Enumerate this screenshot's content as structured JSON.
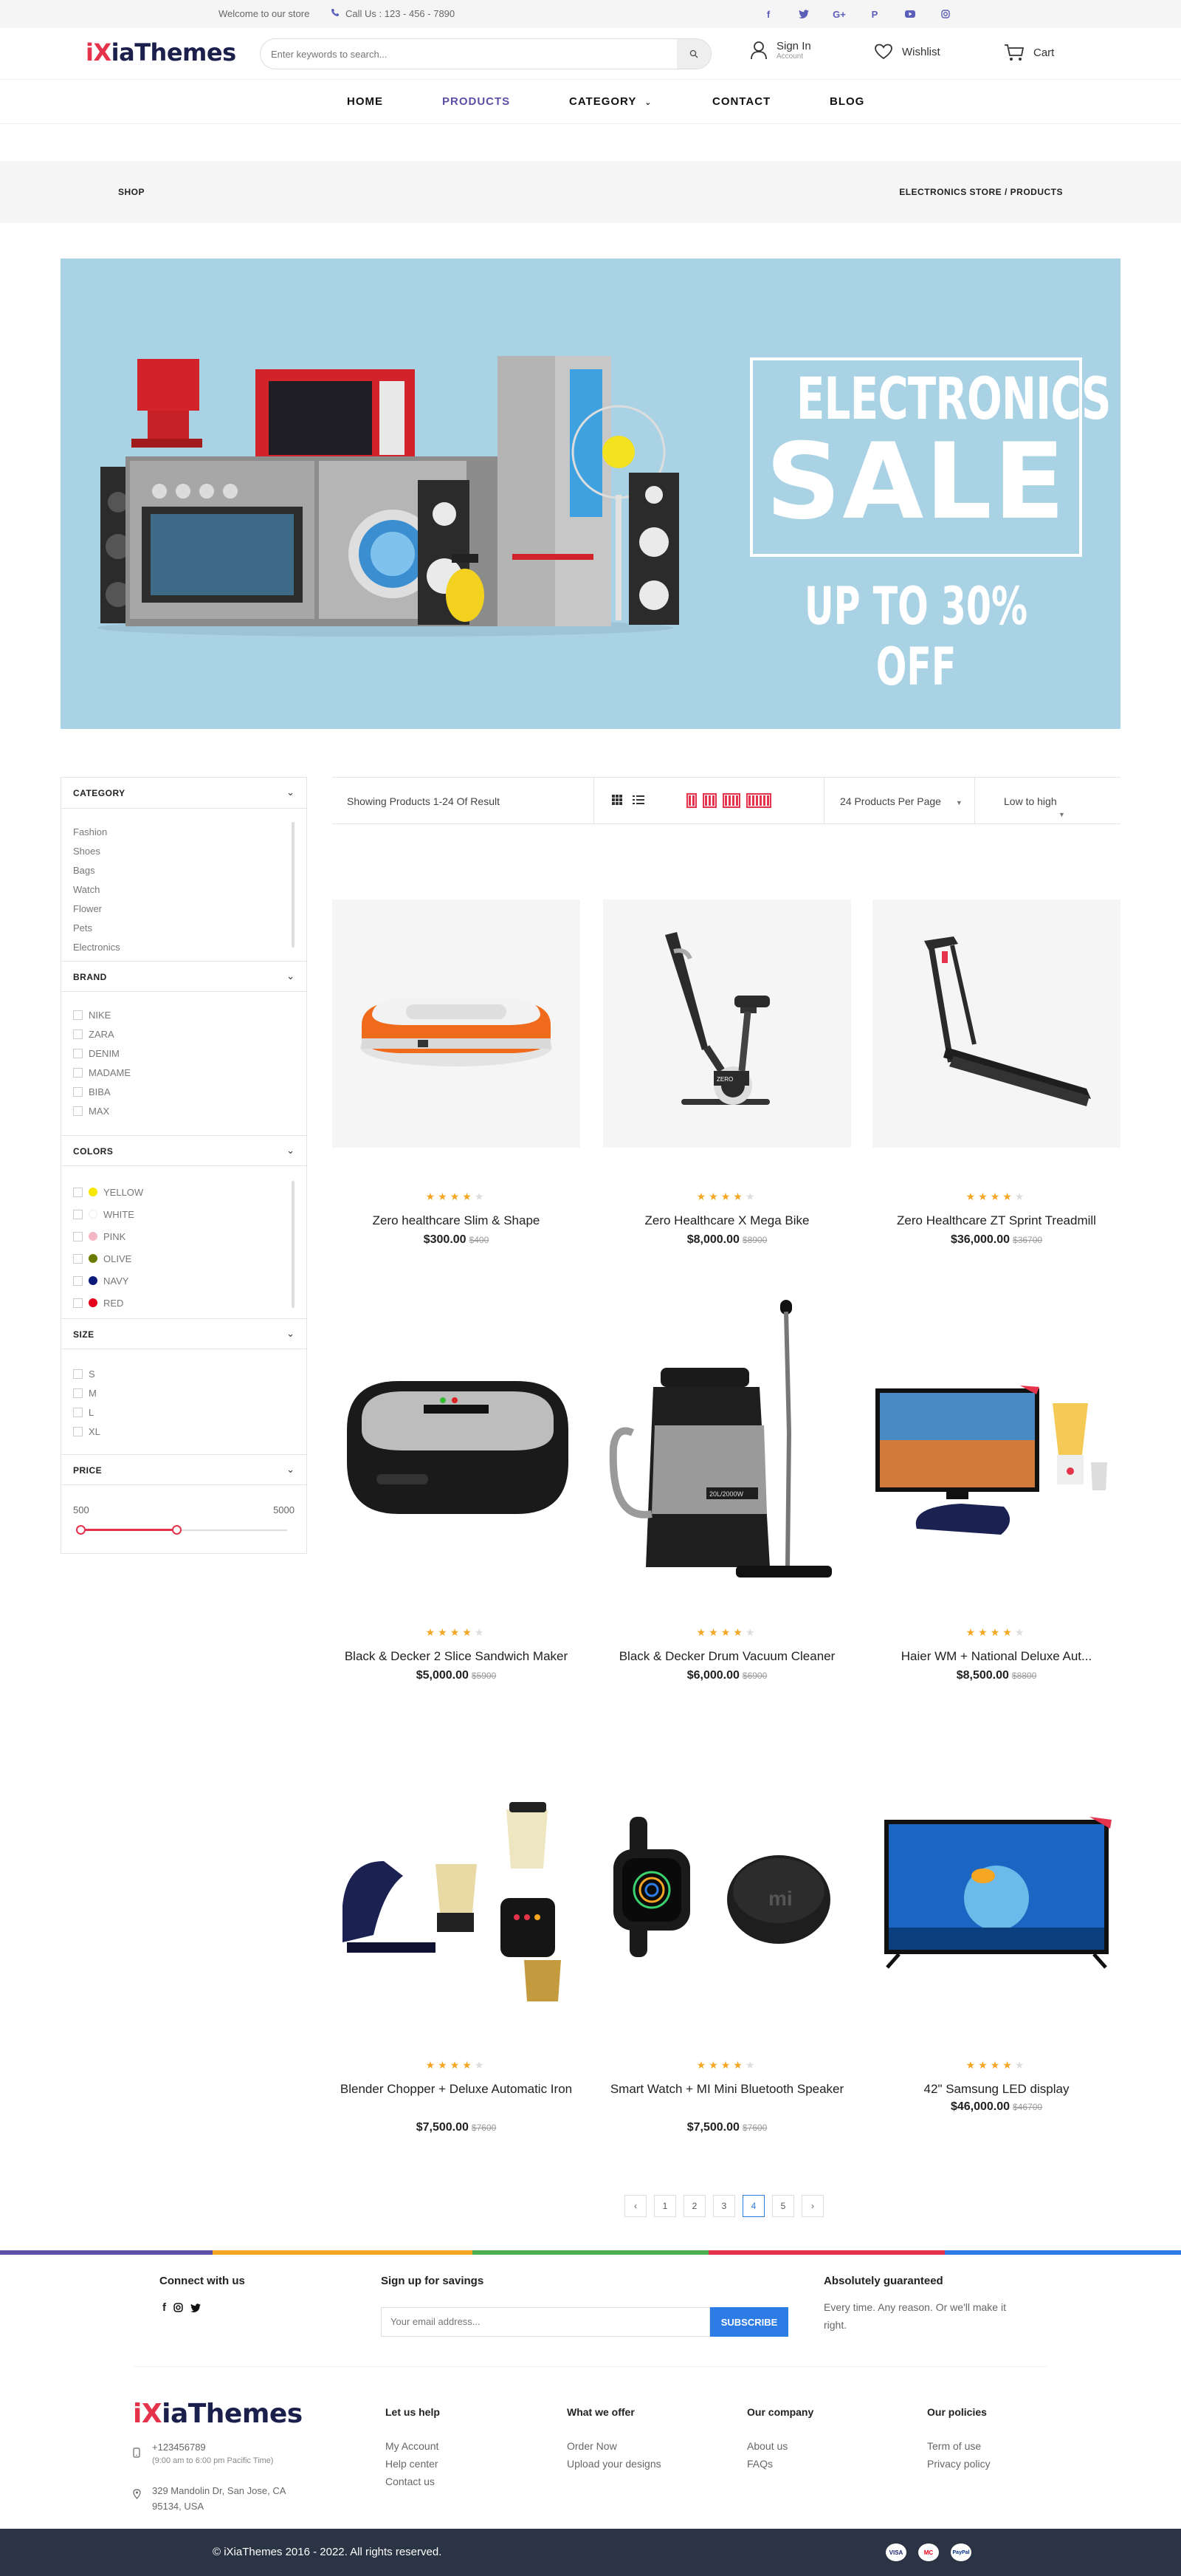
{
  "topbar": {
    "welcome": "Welcome to our store",
    "call": "Call Us : 123 - 456 - 7890",
    "socials": [
      "facebook-icon",
      "twitter-icon",
      "google-plus-icon",
      "pinterest-icon",
      "youtube-icon",
      "instagram-icon"
    ]
  },
  "header": {
    "logo_prefix": "iX",
    "logo_rest": "iaThemes",
    "search_placeholder": "Enter keywords to search...",
    "signin": "Sign In",
    "account": "Account",
    "wishlist": "Wishlist",
    "cart": "Cart"
  },
  "nav": {
    "home": "HOME",
    "products": "PRODUCTS",
    "category": "CATEGORY",
    "contact": "CONTACT",
    "blog": "BLOG"
  },
  "breadcrumb": {
    "left": "SHOP",
    "right": "ELECTRONICS STORE / PRODUCTS"
  },
  "banner": {
    "line1": "ELECTRONICS",
    "line2": "SALE",
    "line3": "UP TO 30% OFF",
    "bg": "#a9d2e4"
  },
  "sidebar": {
    "category": {
      "title": "CATEGORY",
      "items": [
        "Fashion",
        "Shoes",
        "Bags",
        "Watch",
        "Flower",
        "Pets",
        "Electronics"
      ]
    },
    "brand": {
      "title": "BRAND",
      "items": [
        "NIKE",
        "ZARA",
        "DENIM",
        "MADAME",
        "BIBA",
        "MAX"
      ]
    },
    "colors": {
      "title": "COLORS",
      "items": [
        {
          "name": "YELLOW",
          "color": "#f7e600"
        },
        {
          "name": "WHITE",
          "color": "#ffffff"
        },
        {
          "name": "PINK",
          "color": "#f5b7c5"
        },
        {
          "name": "OLIVE",
          "color": "#6b7a00"
        },
        {
          "name": "NAVY",
          "color": "#0a1a7a"
        },
        {
          "name": "RED",
          "color": "#e5001b"
        }
      ]
    },
    "size": {
      "title": "SIZE",
      "items": [
        "S",
        "M",
        "L",
        "XL"
      ]
    },
    "price": {
      "title": "PRICE",
      "min": "500",
      "max": "5000"
    }
  },
  "toolbar": {
    "showing": "Showing Products 1-24 Of Result",
    "per_page": "24 Products Per Page",
    "sort": "Low to high"
  },
  "products": [
    {
      "name": "Zero healthcare Slim & Shape",
      "price": "$300.00",
      "old": "$400",
      "rating": 4
    },
    {
      "name": "Zero Healthcare X Mega Bike",
      "price": "$8,000.00",
      "old": "$8900",
      "rating": 4
    },
    {
      "name": "Zero Healthcare ZT Sprint Treadmill",
      "price": "$36,000.00",
      "old": "$36700",
      "rating": 4
    },
    {
      "name": "Black & Decker 2 Slice Sandwich Maker",
      "price": "$5,000.00",
      "old": "$5900",
      "rating": 4
    },
    {
      "name": "Black & Decker Drum Vacuum Cleaner",
      "price": "$6,000.00",
      "old": "$6900",
      "rating": 4
    },
    {
      "name": "Haier WM + National Deluxe Aut...",
      "price": "$8,500.00",
      "old": "$8800",
      "rating": 4
    },
    {
      "name": "Blender Chopper + Deluxe Automatic Iron",
      "price": "$7,500.00",
      "old": "$7600",
      "rating": 4
    },
    {
      "name": "Smart Watch + MI Mini Bluetooth Speaker",
      "price": "$7,500.00",
      "old": "$7600",
      "rating": 4
    },
    {
      "name": "42\" Samsung LED display",
      "price": "$46,000.00",
      "old": "$46700",
      "rating": 4
    }
  ],
  "pagination": {
    "prev": "‹",
    "pages": [
      "1",
      "2",
      "3",
      "4",
      "5"
    ],
    "active": "4",
    "next": "›"
  },
  "footer": {
    "connect": "Connect with us",
    "signup": "Sign up for savings",
    "email_placeholder": "Your email address...",
    "subscribe": "SUBSCRIBE",
    "guarantee_title": "Absolutely guaranteed",
    "guarantee_text": "Every time. Any reason. Or we'll make it right.",
    "logo_prefix": "iX",
    "logo_rest": "iaThemes",
    "phone": "+123456789",
    "hours": "(9:00 am to 6:00 pm Pacific Time)",
    "address": "329 Mandolin Dr, San Jose, CA 95134, USA",
    "help_title": "Let us help",
    "help_items": [
      "My Account",
      "Help center",
      "Contact us"
    ],
    "offer_title": "What we offer",
    "offer_items": [
      "Order Now",
      "Upload your designs"
    ],
    "company_title": "Our company",
    "company_items": [
      "About us",
      "FAQs"
    ],
    "policies_title": "Our policies",
    "policies_items": [
      "Term of use",
      "Privacy policy"
    ],
    "copyright": "© iXiaThemes 2016 - 2022. All rights reserved.",
    "payments": [
      "VISA",
      "MC",
      "PayPal"
    ]
  },
  "colors": {
    "brand": "#1b1f4c",
    "accent": "#e5334b",
    "nav_active": "#5b4fa6",
    "star": "#f5a623",
    "subscribe": "#2d7be5",
    "bottom_bar": "#2b3444"
  }
}
